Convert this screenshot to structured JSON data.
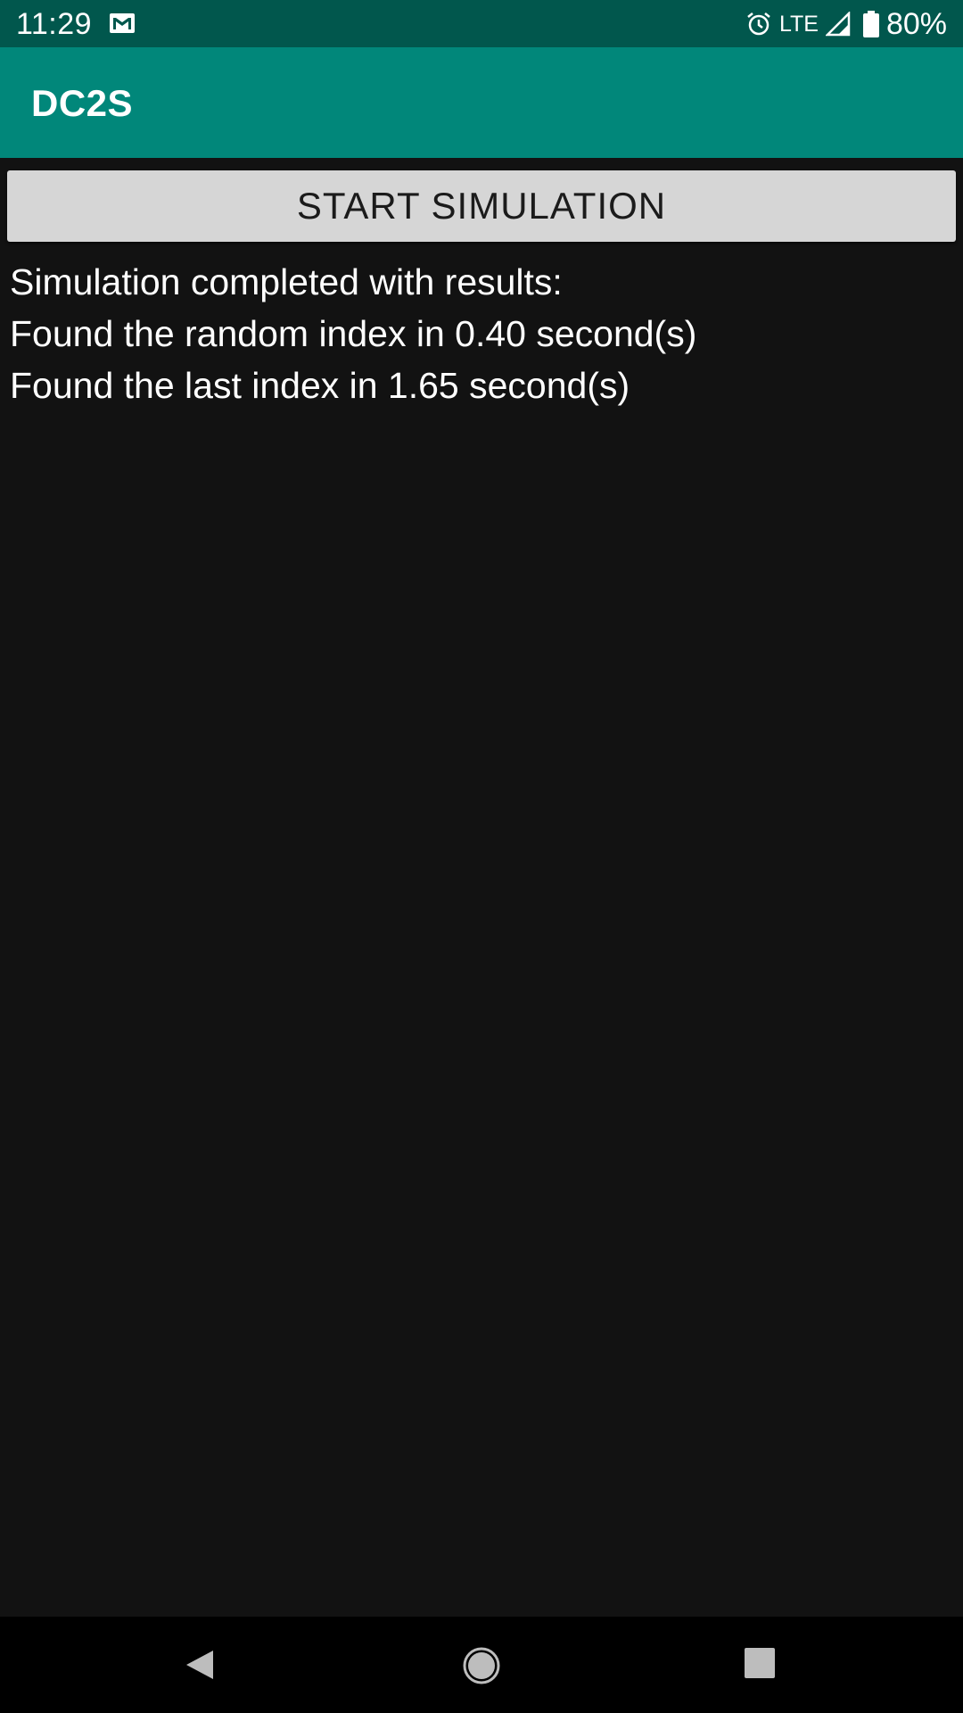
{
  "status_bar": {
    "time": "11:29",
    "network": "LTE",
    "battery_percent": "80%",
    "icons": [
      "gmail-icon",
      "alarm-icon",
      "signal-icon",
      "battery-icon"
    ]
  },
  "app_bar": {
    "title": "DC2S",
    "color": "#01877a"
  },
  "main": {
    "start_button_label": "START SIMULATION",
    "results": [
      "Simulation completed with results:",
      "Found the random index in 0.40 second(s)",
      "Found the last index in 1.65 second(s)"
    ]
  },
  "nav_bar": {
    "icons": [
      "back-icon",
      "home-icon",
      "recents-icon"
    ]
  }
}
